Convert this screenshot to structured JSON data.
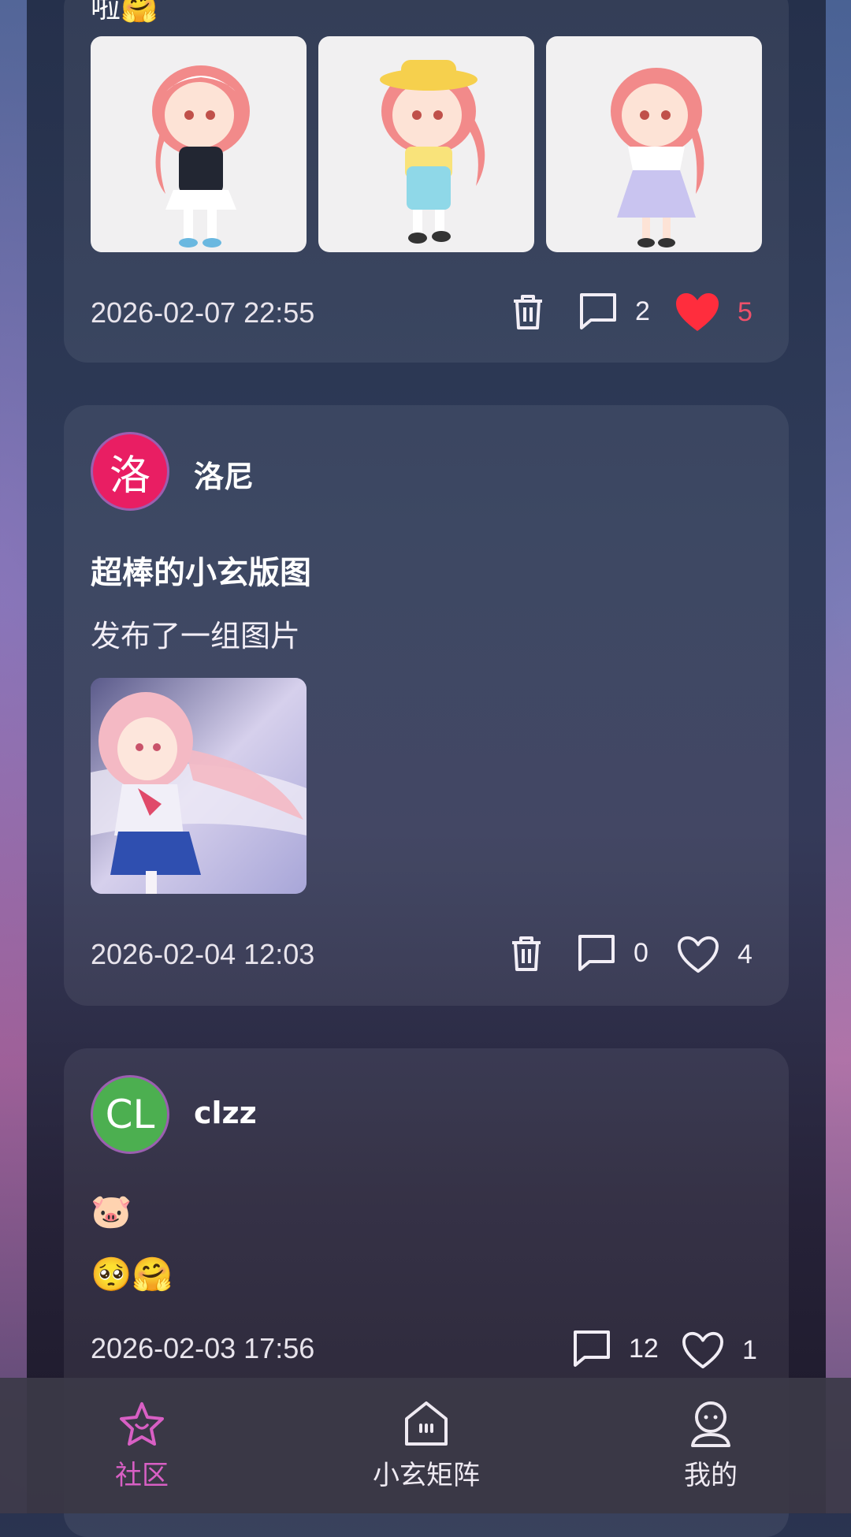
{
  "posts": [
    {
      "partial_text": "啦🤗",
      "images": [
        "maid-outfit-figure",
        "overalls-sunhat-figure",
        "lavender-dress-figure"
      ],
      "timestamp": "2026-02-07 22:55",
      "deletable": true,
      "comments": "2",
      "likes": "5",
      "liked": true
    },
    {
      "avatar_text": "洛",
      "avatar_color": "#e91e63",
      "author": "洛尼",
      "title": "超棒的小玄版图",
      "text": "发布了一组图片",
      "images": [
        "sailor-uniform-illustration"
      ],
      "timestamp": "2026-02-04 12:03",
      "deletable": true,
      "comments": "0",
      "likes": "4",
      "liked": false
    },
    {
      "avatar_text": "CL",
      "avatar_color": "#4caf50",
      "author": "clzz",
      "line1": "🐷",
      "line2": "🥺🤗",
      "timestamp": "2026-02-03 17:56",
      "deletable": false,
      "comments": "12",
      "likes": "1",
      "liked": false
    }
  ],
  "tabs": [
    {
      "label": "社区",
      "icon": "star-icon",
      "active": true
    },
    {
      "label": "小玄矩阵",
      "icon": "bot-chat-icon",
      "active": false
    },
    {
      "label": "我的",
      "icon": "user-icon",
      "active": false
    }
  ],
  "colors": {
    "accent": "#d85fc4",
    "like": "#f0506a",
    "heart": "#ff2d3d"
  }
}
